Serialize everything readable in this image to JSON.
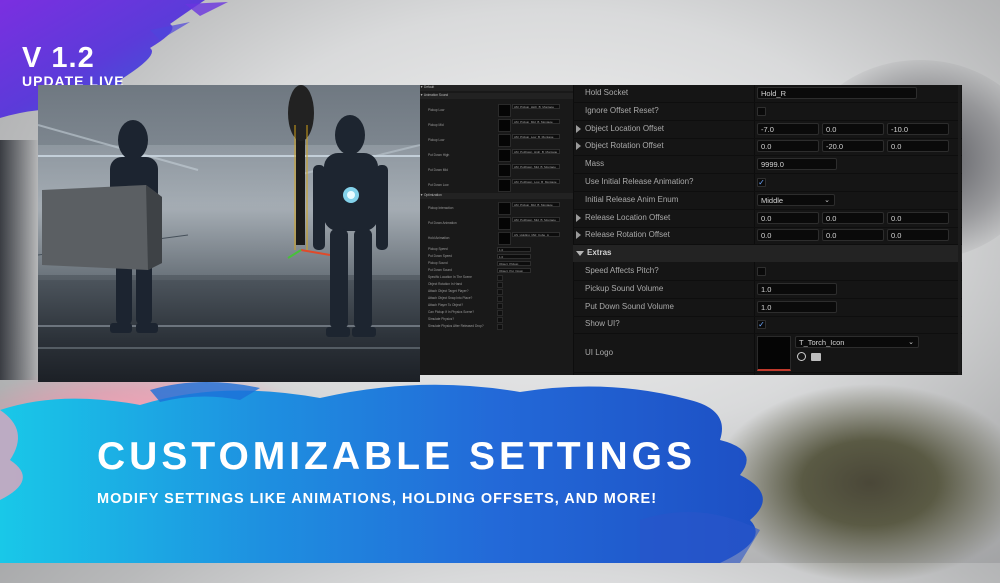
{
  "badge": {
    "version": "V 1.2",
    "status": "UPDATE LIVE"
  },
  "headline": {
    "title": "CUSTOMIZABLE SETTINGS",
    "subtitle": "MODIFY SETTINGS LIKE ANIMATIONS, HOLDING OFFSETS, AND MORE!"
  },
  "mini_panel": {
    "sections": [
      "Default",
      "Animation Sound",
      "Optimization"
    ],
    "rows": [
      {
        "label": "Pickup Low",
        "value": "AM_Pickup_High_B_Montage"
      },
      {
        "label": "Pickup Mid",
        "value": "AM_Pickup_Mid_B_Montage"
      },
      {
        "label": "Pickup Low",
        "value": "AM_Pickup_Low_B_Montage"
      },
      {
        "label": "Put Down High",
        "value": "AM_PutDown_High_B_Montage"
      },
      {
        "label": "Put Down Mid",
        "value": "AM_PutDown_Mid_B_Montage"
      },
      {
        "label": "Put Down Low",
        "value": "AM_PutDown_Low_B_Montage"
      },
      {
        "label": "Pickup Interaction",
        "value": "AM_Pickup_Mid_B_Montage"
      },
      {
        "label": "Put Down Animation",
        "value": "AM_PutDown_Mid_B_Montage"
      },
      {
        "label": "Hold Animation",
        "value": "AS_Holding_Mid_Cube_A"
      },
      {
        "label": "Pickup Speed",
        "value": "1.0"
      },
      {
        "label": "Put Down Speed",
        "value": "1.0"
      },
      {
        "label": "Pickup Sound",
        "value": "Object_Pickup"
      },
      {
        "label": "Put Down Sound",
        "value": "Object_Put_Down"
      }
    ]
  },
  "details": {
    "rows": [
      {
        "label": "Hold Socket",
        "kind": "text",
        "values": [
          "Hold_R"
        ]
      },
      {
        "label": "Ignore Offset Reset?",
        "kind": "check",
        "checked": false
      },
      {
        "label": "Object Location Offset",
        "kind": "vec",
        "expandable": true,
        "values": [
          "-7.0",
          "0.0",
          "-10.0"
        ]
      },
      {
        "label": "Object Rotation Offset",
        "kind": "vec",
        "expandable": true,
        "values": [
          "0.0",
          "-20.0",
          "0.0"
        ]
      },
      {
        "label": "Mass",
        "kind": "text",
        "values": [
          "9999.0"
        ]
      },
      {
        "label": "Use Initial Release Animation?",
        "kind": "check",
        "checked": true
      },
      {
        "label": "Initial Release Anim Enum",
        "kind": "dropdown",
        "values": [
          "Middle"
        ]
      },
      {
        "label": "Release Location Offset",
        "kind": "vec",
        "expandable": true,
        "values": [
          "0.0",
          "0.0",
          "0.0"
        ]
      },
      {
        "label": "Release Rotation Offset",
        "kind": "vec",
        "expandable": true,
        "values": [
          "0.0",
          "0.0",
          "0.0"
        ]
      }
    ],
    "section_extras": "Extras",
    "extras": [
      {
        "label": "Speed Affects Pitch?",
        "kind": "check",
        "checked": false
      },
      {
        "label": "Pickup Sound Volume",
        "kind": "text",
        "values": [
          "1.0"
        ]
      },
      {
        "label": "Put Down Sound Volume",
        "kind": "text",
        "values": [
          "1.0"
        ]
      },
      {
        "label": "Show UI?",
        "kind": "check",
        "checked": true
      }
    ],
    "ui_logo": {
      "label": "UI Logo",
      "asset": "T_Torch_Icon"
    }
  },
  "colors": {
    "brush_purple": "#6a2fd8",
    "brush_blue": "#1f5fd6",
    "brush_cyan": "#22c3e6",
    "panel_bg": "#151515"
  }
}
